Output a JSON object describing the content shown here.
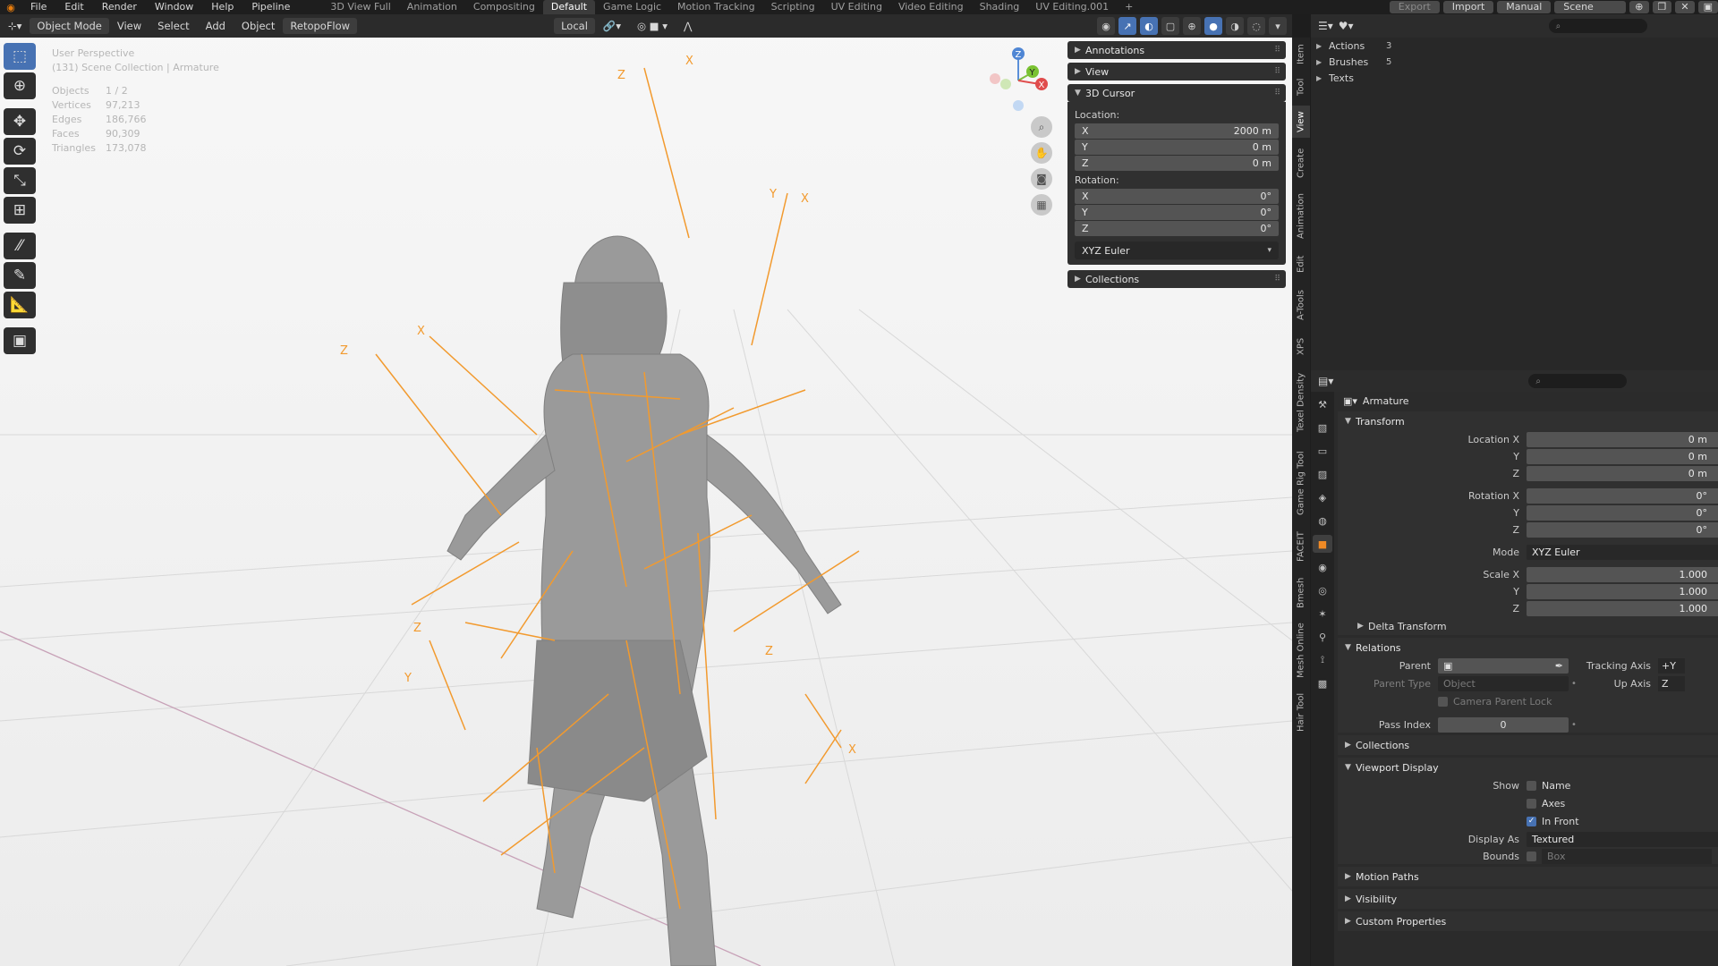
{
  "menu": [
    "File",
    "Edit",
    "Render",
    "Window",
    "Help",
    "Pipeline"
  ],
  "workspaces": [
    "3D View Full",
    "Animation",
    "Compositing",
    "Default",
    "Game Logic",
    "Motion Tracking",
    "Scripting",
    "UV Editing",
    "Video Editing",
    "Shading",
    "UV Editing.001"
  ],
  "active_workspace": "Default",
  "topright": {
    "export": "Export",
    "import": "Import",
    "manual": "Manual",
    "scene": "Scene"
  },
  "viewport_header": {
    "mode": "Object Mode",
    "view": "View",
    "select": "Select",
    "add": "Add",
    "object": "Object",
    "addon": "RetopoFlow",
    "orientation": "Local"
  },
  "overlay": {
    "perspective": "User Perspective",
    "collection": "(131) Scene Collection | Armature",
    "stats": [
      {
        "k": "Objects",
        "v": "1 / 2"
      },
      {
        "k": "Vertices",
        "v": "97,213"
      },
      {
        "k": "Edges",
        "v": "186,766"
      },
      {
        "k": "Faces",
        "v": "90,309"
      },
      {
        "k": "Triangles",
        "v": "173,078"
      }
    ]
  },
  "gizmo": {
    "z": "Z",
    "y": "Y",
    "x": "X"
  },
  "npanel": {
    "annotations": "Annotations",
    "view": "View",
    "cursor": "3D Cursor",
    "location_label": "Location:",
    "location": [
      {
        "axis": "X",
        "val": "2000 m"
      },
      {
        "axis": "Y",
        "val": "0 m"
      },
      {
        "axis": "Z",
        "val": "0 m"
      }
    ],
    "rotation_label": "Rotation:",
    "rotation": [
      {
        "axis": "X",
        "val": "0°"
      },
      {
        "axis": "Y",
        "val": "0°"
      },
      {
        "axis": "Z",
        "val": "0°"
      }
    ],
    "rotation_mode": "XYZ Euler",
    "collections": "Collections"
  },
  "vtabs": [
    "Item",
    "Tool",
    "View",
    "Create",
    "Animation",
    "Edit",
    "A-Tools",
    "XPS",
    "Texel Density",
    "Game Rig Tool",
    "FACEIT",
    "Bmesh",
    "Mesh Online",
    "Hair Tool"
  ],
  "outliner": [
    {
      "name": "Actions",
      "extra": "3"
    },
    {
      "name": "Brushes",
      "extra": "5"
    },
    {
      "name": "Texts",
      "extra": ""
    }
  ],
  "properties": {
    "object_name": "Armature",
    "transform": "Transform",
    "location": [
      {
        "lbl": "Location X",
        "val": "0 m"
      },
      {
        "lbl": "Y",
        "val": "0 m"
      },
      {
        "lbl": "Z",
        "val": "0 m"
      }
    ],
    "rotation": [
      {
        "lbl": "Rotation X",
        "val": "0°"
      },
      {
        "lbl": "Y",
        "val": "0°"
      },
      {
        "lbl": "Z",
        "val": "0°"
      }
    ],
    "mode_label": "Mode",
    "mode_val": "XYZ Euler",
    "scale": [
      {
        "lbl": "Scale X",
        "val": "1.000"
      },
      {
        "lbl": "Y",
        "val": "1.000"
      },
      {
        "lbl": "Z",
        "val": "1.000"
      }
    ],
    "delta": "Delta Transform",
    "relations": "Relations",
    "parent_label": "Parent",
    "tracking_label": "Tracking Axis",
    "tracking_val": "+Y",
    "parent_type_label": "Parent Type",
    "parent_type_val": "Object",
    "up_axis_label": "Up Axis",
    "up_axis_val": "Z",
    "camera_lock": "Camera Parent Lock",
    "pass_index_label": "Pass Index",
    "pass_index_val": "0",
    "collections": "Collections",
    "viewport_display": "Viewport Display",
    "show_label": "Show",
    "show_name": "Name",
    "show_axes": "Axes",
    "show_infront": "In Front",
    "display_as_label": "Display As",
    "display_as_val": "Textured",
    "bounds_label": "Bounds",
    "bounds_val": "Box",
    "motion_paths": "Motion Paths",
    "visibility": "Visibility",
    "custom_props": "Custom Properties"
  },
  "colors": {
    "accent": "#4772b3",
    "bone": "#f29a2e",
    "selected_tab": "#f08a25"
  }
}
